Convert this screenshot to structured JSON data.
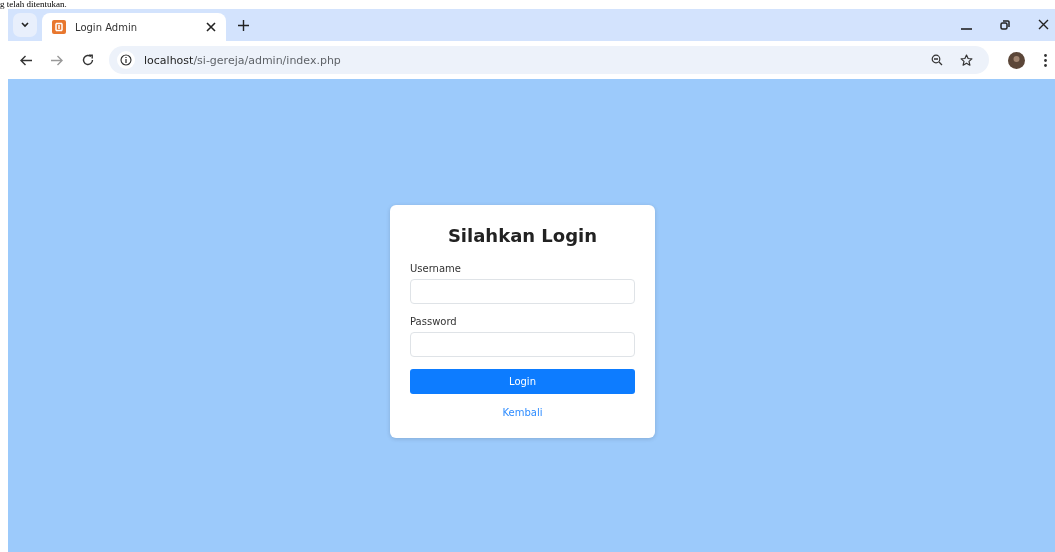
{
  "document_text": "g telah ditentukan.",
  "browser": {
    "tabs": [
      {
        "title": "Login Admin",
        "selected": true
      }
    ],
    "address": {
      "host": "localhost",
      "path": "/si-gereja/admin/index.php"
    }
  },
  "login": {
    "title": "Silahkan Login",
    "fields": [
      {
        "label": "Username"
      },
      {
        "label": "Password"
      }
    ],
    "button": "Login",
    "link": "Kembali"
  }
}
